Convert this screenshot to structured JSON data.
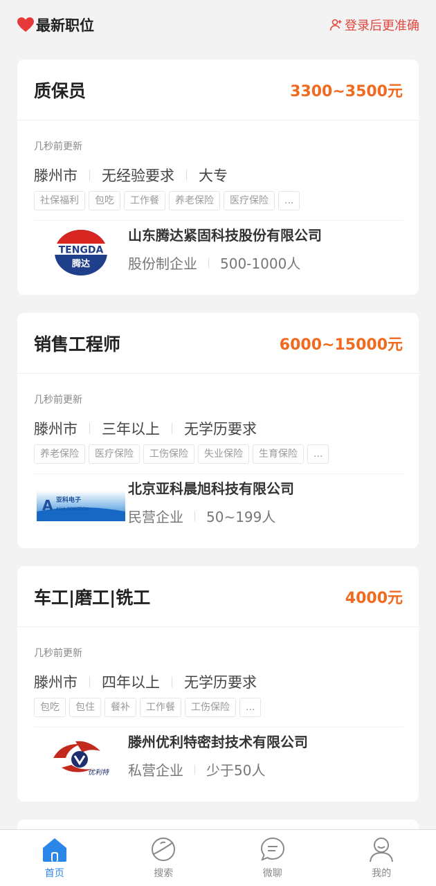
{
  "header": {
    "title": "最新职位",
    "login_hint": "登录后更准确",
    "accent_color": "#e2463c"
  },
  "jobs": [
    {
      "title": "质保员",
      "salary": "3300~3500元",
      "updated": "几秒前更新",
      "city": "滕州市",
      "experience": "无经验要求",
      "education": "大专",
      "tags": [
        "社保福利",
        "包吃",
        "工作餐",
        "养老保险",
        "医疗保险",
        "..."
      ],
      "company": {
        "name": "山东腾达紧固科技股份有限公司",
        "type": "股份制企业",
        "size": "500-1000人",
        "logo_text": "TENGDA",
        "logo_subtext": "腾达"
      }
    },
    {
      "title": "销售工程师",
      "salary": "6000~15000元",
      "updated": "几秒前更新",
      "city": "滕州市",
      "experience": "三年以上",
      "education": "无学历要求",
      "tags": [
        "养老保险",
        "医疗保险",
        "工伤保险",
        "失业保险",
        "生育保险",
        "..."
      ],
      "company": {
        "name": "北京亚科晨旭科技有限公司",
        "type": "民营企业",
        "size": "50~199人",
        "logo_text": "亚科电子",
        "logo_subtext": "ASIA SCI&TECH"
      }
    },
    {
      "title": "车工|磨工|铣工",
      "salary": "4000元",
      "updated": "几秒前更新",
      "city": "滕州市",
      "experience": "四年以上",
      "education": "无学历要求",
      "tags": [
        "包吃",
        "包住",
        "餐补",
        "工作餐",
        "工伤保险",
        "..."
      ],
      "company": {
        "name": "滕州优利特密封技术有限公司",
        "type": "私营企业",
        "size": "少于50人",
        "logo_text": "优利特"
      }
    }
  ],
  "tabbar": {
    "items": [
      {
        "label": "首页",
        "icon": "home-icon",
        "active": true
      },
      {
        "label": "搜索",
        "icon": "search-planet-icon",
        "active": false
      },
      {
        "label": "微聊",
        "icon": "chat-icon",
        "active": false
      },
      {
        "label": "我的",
        "icon": "profile-icon",
        "active": false
      }
    ],
    "active_color": "#2c86e8"
  },
  "colors": {
    "salary": "#f06a1f",
    "background": "#f3f3f3"
  }
}
